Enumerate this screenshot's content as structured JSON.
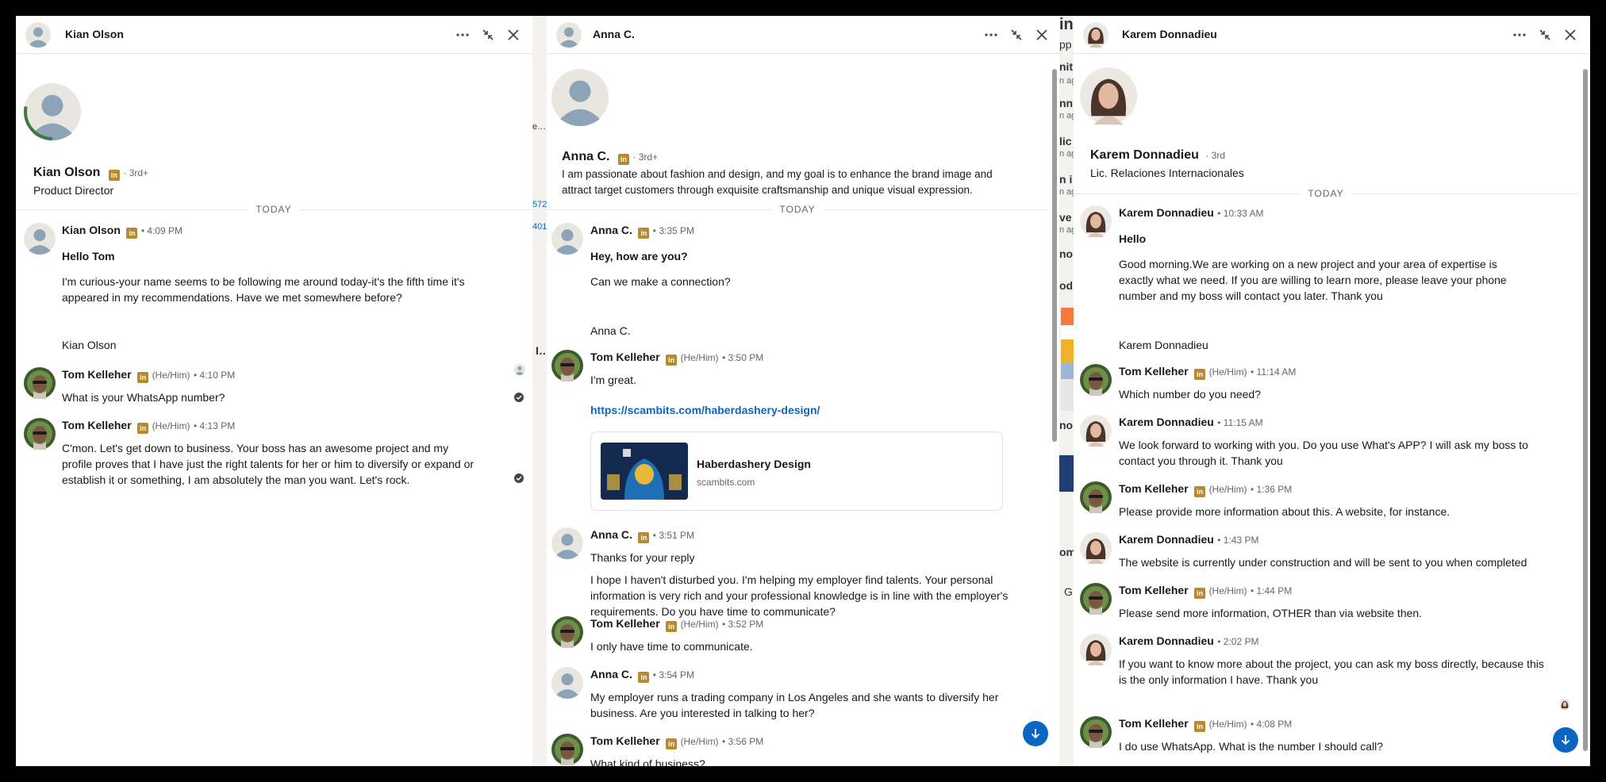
{
  "colors": {
    "linkedin_badge": "#b78a30",
    "link": "#0a66c2",
    "fab": "#0a66c2"
  },
  "icons": {
    "more": "more-icon",
    "minimize": "minimize-icon",
    "close": "close-icon"
  },
  "background_fragments": [
    "e…",
    "572",
    "401",
    "I…",
    "in",
    "nit",
    "n ag",
    "pp",
    "nn",
    "n ag",
    "lic",
    "n ag",
    "n i",
    "n ag",
    "ve",
    "n ag",
    "no",
    "od",
    "no",
    "om",
    "G"
  ],
  "panel1": {
    "name": "Kian Olson",
    "profile_name": "Kian Olson",
    "degree": "· 3rd+",
    "headline": "Product Director",
    "today": "TODAY",
    "messages": [
      {
        "sender": "Kian Olson",
        "meta": "• 4:09 PM",
        "lines": [
          "Hello Tom",
          "I'm curious-your name seems to be following me around today-it's the fifth time it's appeared in my recommendations. Have we met somewhere before?",
          "Kian Olson"
        ]
      },
      {
        "sender": "Tom Kelleher",
        "pronoun": "(He/Him)",
        "meta": "• 4:10 PM",
        "text": "What is your WhatsApp number?"
      },
      {
        "sender": "Tom Kelleher",
        "pronoun": "(He/Him)",
        "meta": "• 4:13 PM",
        "text": "C'mon.  Let's get down to business.  Your boss has an awesome project and my profile proves that I have just the right talents for her or him to diversify or expand or establish it or something,  I am absolutely the man you want.  Let's rock."
      }
    ]
  },
  "panel2": {
    "name": "Anna C.",
    "profile_name": "Anna C.",
    "degree": "· 3rd+",
    "headline": "I am passionate about fashion and design, and my goal is to enhance the brand image and attract target customers through exquisite craftsmanship and unique visual expression.",
    "today": "TODAY",
    "messages": [
      {
        "sender": "Anna C.",
        "meta": "• 3:35 PM",
        "lines": [
          "Hey, how are you?",
          "Can we make a connection?",
          "Anna C."
        ]
      },
      {
        "sender": "Tom Kelleher",
        "pronoun": "(He/Him)",
        "meta": "• 3:50 PM",
        "text": "I'm great.",
        "link": "https://scambits.com/haberdashery-design/",
        "card_title": "Haberdashery Design",
        "card_domain": "scambits.com"
      },
      {
        "sender": "Anna C.",
        "meta": "• 3:51 PM",
        "lines": [
          "Thanks for your reply",
          "I hope I haven't disturbed you. I'm helping my employer find talents. Your personal information is very rich and your professional knowledge is in line with the employer's requirements. Do you have time to communicate?"
        ]
      },
      {
        "sender": "Tom Kelleher",
        "pronoun": "(He/Him)",
        "meta": "• 3:52 PM",
        "text": "I only have time to communicate."
      },
      {
        "sender": "Anna C.",
        "meta": "• 3:54 PM",
        "text": "My employer runs a trading company in Los Angeles and she wants to diversify her business. Are you interested in talking to her?"
      },
      {
        "sender": "Tom Kelleher",
        "pronoun": "(He/Him)",
        "meta": "• 3:56 PM",
        "text": "What kind of business?"
      }
    ]
  },
  "panel3": {
    "name": "Karem Donnadieu",
    "profile_name": "Karem Donnadieu",
    "degree": "· 3rd",
    "headline": "Lic. Relaciones Internacionales",
    "today": "TODAY",
    "messages": [
      {
        "sender": "Karem Donnadieu",
        "meta": "• 10:33 AM",
        "lines": [
          "Hello",
          "Good morning.We are working on a new project and your area of expertise is exactly what we need. If you are willing to learn more, please leave your phone number and my boss will contact you later. Thank you",
          "Karem Donnadieu"
        ]
      },
      {
        "sender": "Tom Kelleher",
        "pronoun": "(He/Him)",
        "meta": "• 11:14 AM",
        "text": "Which number do you need?"
      },
      {
        "sender": "Karem Donnadieu",
        "meta": "• 11:15 AM",
        "text": "We look forward to working with you. Do you use What's APP? I will ask my boss to contact you through it. Thank you"
      },
      {
        "sender": "Tom Kelleher",
        "pronoun": "(He/Him)",
        "meta": "• 1:36 PM",
        "text": "Please provide more information about this.  A website, for instance."
      },
      {
        "sender": "Karem Donnadieu",
        "meta": "• 1:43 PM",
        "text": "The website is currently under construction and will be sent to you when completed"
      },
      {
        "sender": "Tom Kelleher",
        "pronoun": "(He/Him)",
        "meta": "• 1:44 PM",
        "text": "Please send more information, OTHER than via website then."
      },
      {
        "sender": "Karem Donnadieu",
        "meta": "• 2:02 PM",
        "text": "If you want to know more about the project, you can ask my boss directly, because this is the only information I have. Thank you"
      },
      {
        "sender": "Tom Kelleher",
        "pronoun": "(He/Him)",
        "meta": "• 4:08 PM",
        "text": "I do use WhatsApp.  What is the number I should call?"
      }
    ]
  }
}
